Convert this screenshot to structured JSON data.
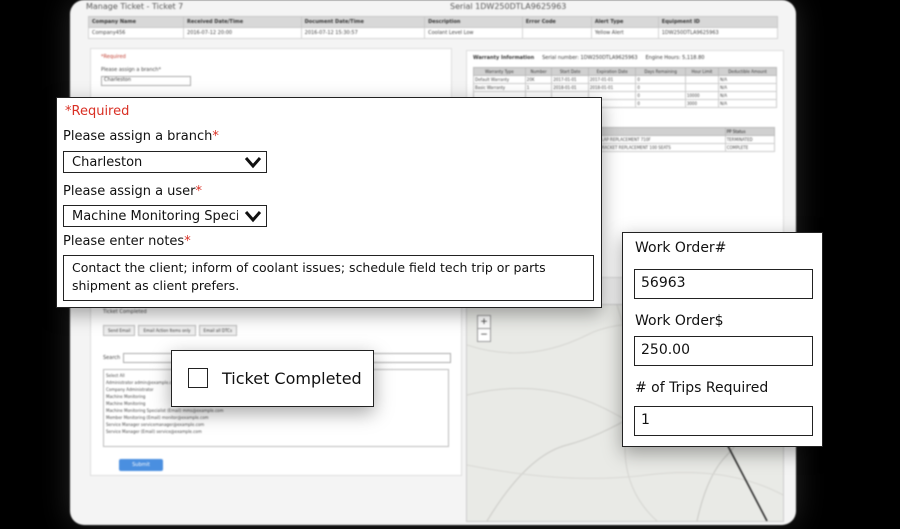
{
  "background": {
    "title": "Manage Ticket - Ticket 7",
    "serial": "Serial 1DW250DTLA9625963",
    "summary_table": {
      "headers": [
        "Company Name",
        "Received Date/Time",
        "Document Date/Time",
        "Description",
        "Error Code",
        "Alert Type",
        "Equipment ID"
      ],
      "row": [
        "Company456",
        "2016-07-12 20:00",
        "2016-07-12 15:30:57",
        "Coolant Level Low",
        "",
        "Yellow Alert",
        "1DW250DTLA9625963"
      ]
    },
    "assign_panel": {
      "required": "*Required",
      "branch_label": "Please assign a branch*",
      "branch_value": "Charleston"
    },
    "warranty": {
      "title": "Warranty Information",
      "serial": "Serial number: 1DW250DTLA9625963",
      "engine_hours": "Engine Hours: 5,118.80",
      "headers": [
        "Warranty Type",
        "Number",
        "Start Date",
        "Expiration Date",
        "Days Remaining",
        "Hour Limit",
        "Deductible Amount"
      ],
      "rows": [
        [
          "Default Warranty",
          "20K",
          "2017-01-01",
          "2017-01-01",
          "0",
          "",
          "N/A"
        ],
        [
          "Basic Warranty",
          "1",
          "2018-01-01",
          "2018-01-01",
          "0",
          "",
          "N/A"
        ],
        [
          "",
          "",
          "",
          "",
          "0",
          "10000",
          "N/A"
        ],
        [
          "",
          "",
          "",
          "",
          "0",
          "3000",
          "N/A"
        ]
      ],
      "pp_headers": [
        "",
        "PP Status"
      ],
      "pp_rows": [
        [
          "FLAP REPLACEMENT 710F",
          "TERMINATED"
        ],
        [
          "BRACKET REPLACEMENT 100 SEATS",
          "COMPLETE"
        ]
      ]
    },
    "completion_panel": {
      "label": "Ticket Completed",
      "tabs": [
        "Send Email",
        "Email Action Items only",
        "Email all DTCs"
      ],
      "search_label": "Search",
      "list_items": [
        "Select All",
        "Administrator admin@example.com",
        "Company Administrator",
        "Machine Monitoring",
        "Machine Monitoring",
        "Machine Monitoring Specialist (Email) mms@example.com",
        "Member Monitoring (Email) monitor@example.com",
        "Service Manager servicemanager@example.com",
        "Service Manager (Email) service@example.com"
      ],
      "submit": "Submit"
    }
  },
  "form": {
    "required_note": "*Required",
    "branch_label": "Please assign a branch",
    "branch_value": "Charleston",
    "user_label": "Please assign a user",
    "user_value": "Machine Monitoring Specialist",
    "notes_label": "Please enter notes",
    "notes_value": "Contact the client; inform of coolant issues; schedule field tech trip or parts shipment as client prefers.",
    "asterisk": "*"
  },
  "ticket": {
    "label": "Ticket Completed",
    "checked": false
  },
  "work_order": {
    "number_label": "Work Order#",
    "number_value": "56963",
    "amount_label": "Work Order$",
    "amount_value": "250.00",
    "trips_label": "# of Trips Required",
    "trips_value": "1"
  },
  "map": {
    "zoom_in": "+",
    "zoom_out": "−"
  },
  "icons": [
    "chevron-down-icon",
    "zoom-in-icon",
    "zoom-out-icon",
    "checkbox-icon"
  ],
  "colors": {
    "required_red": "#d93025",
    "submit_blue": "#4a8fe0",
    "backdrop": "#000000"
  }
}
